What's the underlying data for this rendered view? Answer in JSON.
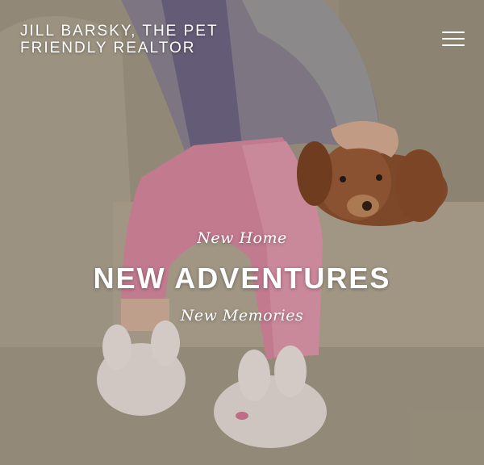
{
  "header": {
    "site_title": "JILL BARSKY, THE PET FRIENDLY REALTOR",
    "menu_icon": "hamburger-menu-icon"
  },
  "hero": {
    "line_top": "New Home",
    "headline": "NEW ADVENTURES",
    "line_bottom": "New Memories",
    "image_subject": "child-and-puppy-on-couch-photo"
  }
}
